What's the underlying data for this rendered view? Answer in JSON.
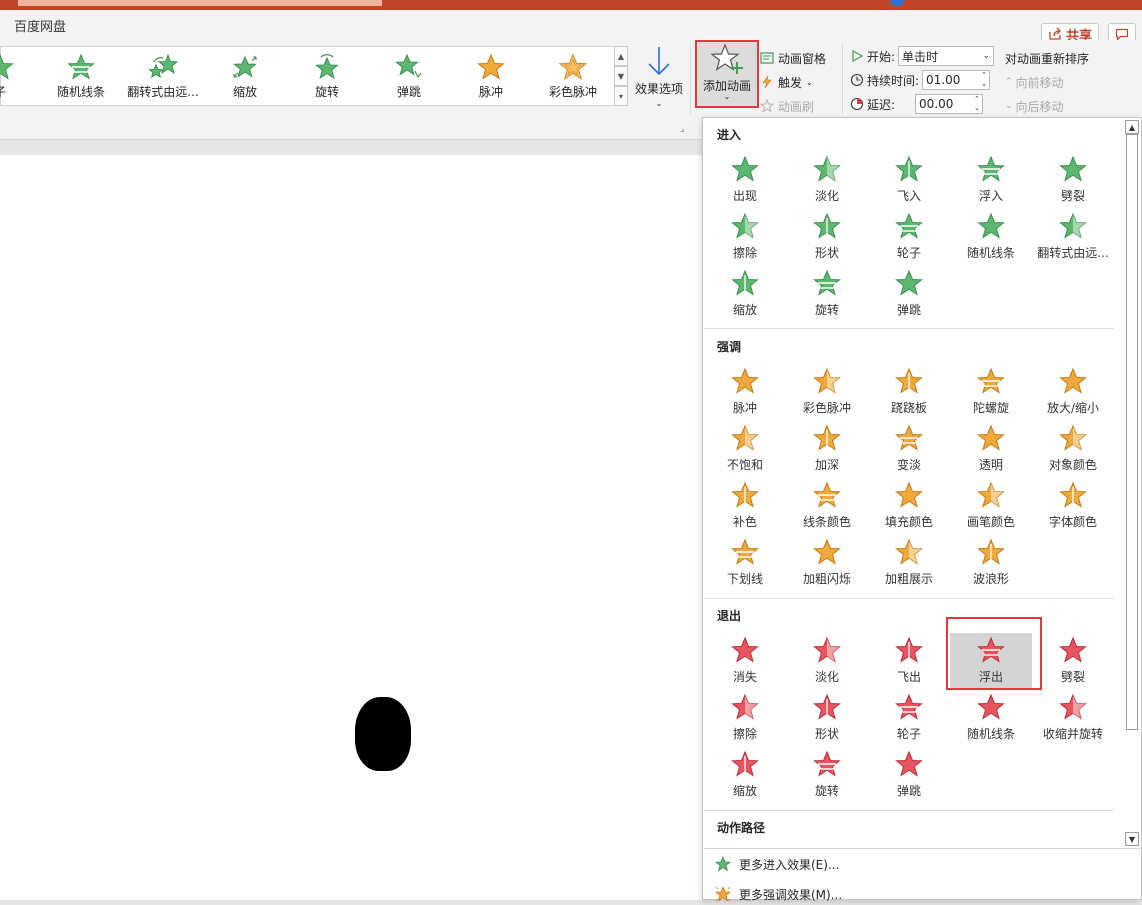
{
  "window": {
    "tab": "百度网盘"
  },
  "header": {
    "share_label": "共享",
    "share_icon": "share-icon",
    "comment_icon": "comment-icon"
  },
  "colors": {
    "entrance": "#5cb870",
    "emphasis": "#f2a93b",
    "exit": "#e8545f",
    "accent": "#c0452a",
    "highlight_box": "#e03a3a"
  },
  "ribbon": {
    "gallery": [
      "子",
      "随机线条",
      "翻转式由远...",
      "缩放",
      "旋转",
      "弹跳",
      "脉冲",
      "彩色脉冲"
    ],
    "effect_options": "效果选项",
    "add_animation": "添加动画",
    "animation_pane": "动画窗格",
    "trigger": "触发",
    "animation_painter": "动画刷",
    "start_label": "开始:",
    "start_value": "单击时",
    "duration_label": "持续时间:",
    "duration_value": "01.00",
    "delay_label": "延迟:",
    "delay_value": "00.00",
    "reorder_title": "对动画重新排序",
    "move_earlier": "向前移动",
    "move_later": "向后移动"
  },
  "dropdown": {
    "entrance": {
      "title": "进入",
      "items": [
        "出现",
        "淡化",
        "飞入",
        "浮入",
        "劈裂",
        "擦除",
        "形状",
        "轮子",
        "随机线条",
        "翻转式由远...",
        "缩放",
        "旋转",
        "弹跳"
      ]
    },
    "emphasis": {
      "title": "强调",
      "items": [
        "脉冲",
        "彩色脉冲",
        "跷跷板",
        "陀螺旋",
        "放大/缩小",
        "不饱和",
        "加深",
        "变淡",
        "透明",
        "对象颜色",
        "补色",
        "线条颜色",
        "填充颜色",
        "画笔颜色",
        "字体颜色",
        "下划线",
        "加粗闪烁",
        "加粗展示",
        "波浪形"
      ]
    },
    "exit": {
      "title": "退出",
      "items": [
        "消失",
        "淡化",
        "飞出",
        "浮出",
        "劈裂",
        "擦除",
        "形状",
        "轮子",
        "随机线条",
        "收缩并旋转",
        "缩放",
        "旋转",
        "弹跳"
      ],
      "selected": "浮出"
    },
    "motion_path": {
      "title": "动作路径"
    },
    "more_entrance": "更多进入效果(E)...",
    "more_emphasis": "更多强调效果(M)..."
  }
}
